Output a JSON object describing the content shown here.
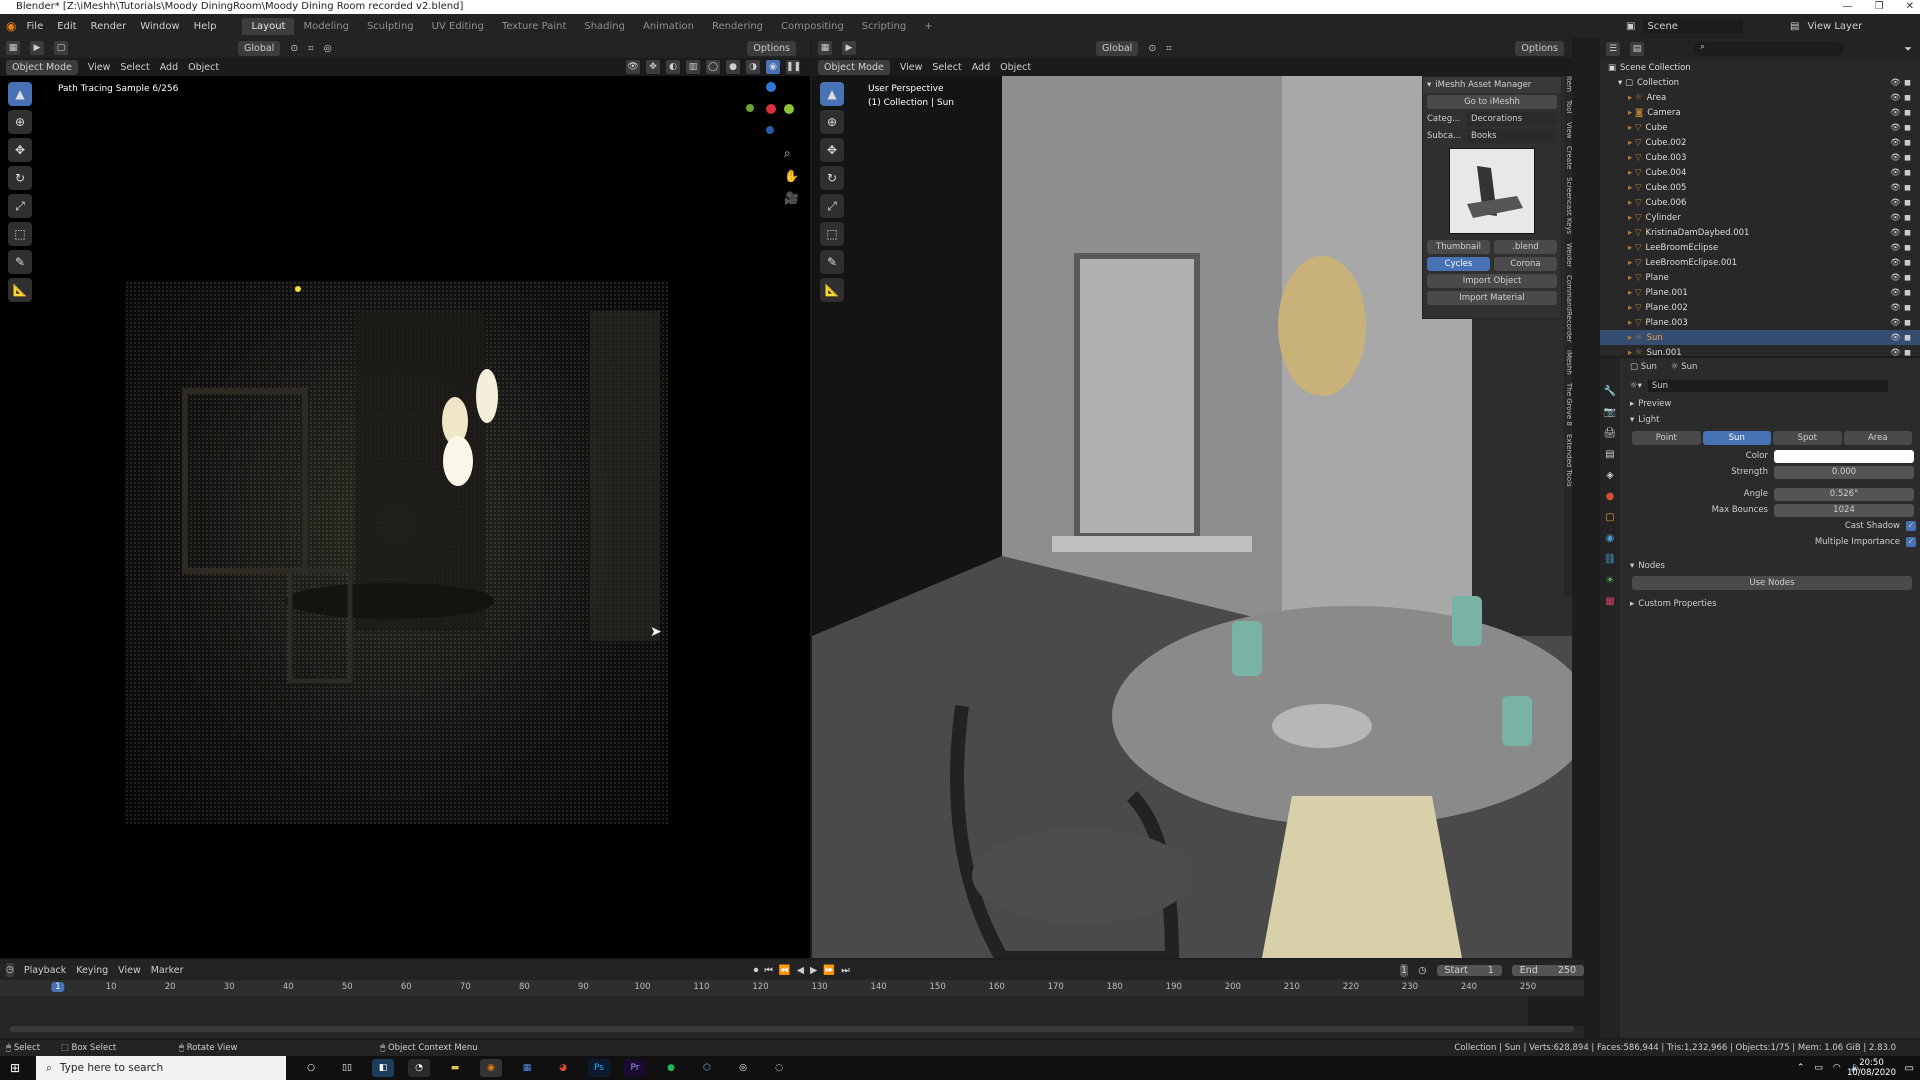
{
  "window": {
    "title": "Blender* [Z:\\iMeshh\\Tutorials\\Moody DiningRoom\\Moody Dining Room recorded v2.blend]"
  },
  "menu": [
    "File",
    "Edit",
    "Render",
    "Window",
    "Help"
  ],
  "workspaces": [
    "Layout",
    "Modeling",
    "Sculpting",
    "UV Editing",
    "Texture Paint",
    "Shading",
    "Animation",
    "Rendering",
    "Compositing",
    "Scripting",
    "+"
  ],
  "active_workspace": "Layout",
  "scene": {
    "label": "Scene",
    "view_layer": "View Layer"
  },
  "left_viewport": {
    "transform": "Global",
    "options": "Options",
    "mode": "Object Mode",
    "menus": [
      "View",
      "Select",
      "Add",
      "Object"
    ],
    "status": "Path Tracing Sample 6/256"
  },
  "right_viewport": {
    "transform": "Global",
    "options": "Options",
    "mode": "Object Mode",
    "menus": [
      "View",
      "Select",
      "Add",
      "Object"
    ],
    "perspective": "User Perspective",
    "collection": "(1) Collection | Sun"
  },
  "imeshh": {
    "title": "iMeshh Asset Manager",
    "go_to": "Go to iMeshh",
    "category_label": "Categ...",
    "category_value": "Decorations",
    "subcategory_label": "Subca...",
    "subcategory_value": "Books",
    "thumbnail_btn": "Thumbnail",
    "blend_btn": ".blend",
    "engine_cycles": "Cycles",
    "engine_corona": "Corona",
    "import_object": "Import Object",
    "import_material": "Import Material"
  },
  "vertical_tabs": [
    "Item",
    "Tool",
    "View",
    "Create",
    "Screencast Keys",
    "Weider",
    "CommandRecorder",
    "iMeshh",
    "The Grove 8",
    "Extended Tools"
  ],
  "outliner": {
    "root": "Scene Collection",
    "collection": "Collection",
    "items": [
      "Area",
      "Camera",
      "Cube",
      "Cube.002",
      "Cube.003",
      "Cube.004",
      "Cube.005",
      "Cube.006",
      "Cylinder",
      "KristinaDamDaybed.001",
      "LeeBroomEclipse",
      "LeeBroomEclipse.001",
      "Plane",
      "Plane.001",
      "Plane.002",
      "Plane.003",
      "Sun",
      "Sun.001"
    ],
    "selected": "Sun"
  },
  "properties": {
    "object": "Sun",
    "data": "Sun",
    "datablock": "Sun",
    "sections": {
      "preview": "Preview",
      "light": "Light",
      "nodes": "Nodes",
      "custom": "Custom Properties"
    },
    "light_types": [
      "Point",
      "Sun",
      "Spot",
      "Area"
    ],
    "active_type": "Sun",
    "color_label": "Color",
    "strength_label": "Strength",
    "strength": "0.000",
    "angle_label": "Angle",
    "angle": "0.526°",
    "max_bounces_label": "Max Bounces",
    "max_bounces": "1024",
    "cast_shadow": "Cast Shadow",
    "multiple_importance": "Multiple Importance",
    "use_nodes": "Use Nodes"
  },
  "timeline": {
    "menus": [
      "Playback",
      "Keying",
      "View",
      "Marker"
    ],
    "current_frame": "1",
    "start_label": "Start",
    "start": "1",
    "end_label": "End",
    "end": "250",
    "ticks": [
      "1",
      "10",
      "20",
      "30",
      "40",
      "50",
      "60",
      "70",
      "80",
      "90",
      "100",
      "110",
      "120",
      "130",
      "140",
      "150",
      "160",
      "170",
      "180",
      "190",
      "200",
      "210",
      "220",
      "230",
      "240",
      "250"
    ]
  },
  "statusbar": {
    "select": "Select",
    "box_select": "Box Select",
    "rotate_view": "Rotate View",
    "context_menu": "Object Context Menu",
    "stats": "Collection | Sun | Verts:628,894 | Faces:586,944 | Tris:1,232,966 | Objects:1/75 | Mem: 1.06 GiB | 2.83.0"
  },
  "taskbar": {
    "search_placeholder": "Type here to search",
    "time": "20:50",
    "date": "10/08/2020",
    "apps": [
      "Ps",
      "Pr"
    ]
  }
}
